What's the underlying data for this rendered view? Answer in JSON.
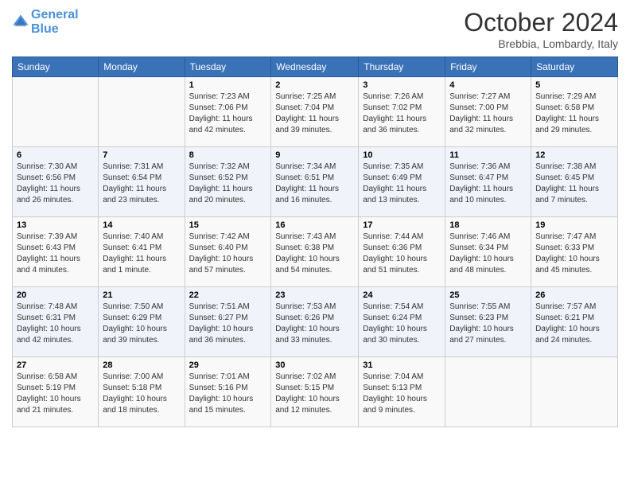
{
  "header": {
    "logo_line1": "General",
    "logo_line2": "Blue",
    "month": "October 2024",
    "location": "Brebbia, Lombardy, Italy"
  },
  "columns": [
    "Sunday",
    "Monday",
    "Tuesday",
    "Wednesday",
    "Thursday",
    "Friday",
    "Saturday"
  ],
  "weeks": [
    [
      {
        "day": "",
        "info": ""
      },
      {
        "day": "",
        "info": ""
      },
      {
        "day": "1",
        "info": "Sunrise: 7:23 AM\nSunset: 7:06 PM\nDaylight: 11 hours and 42 minutes."
      },
      {
        "day": "2",
        "info": "Sunrise: 7:25 AM\nSunset: 7:04 PM\nDaylight: 11 hours and 39 minutes."
      },
      {
        "day": "3",
        "info": "Sunrise: 7:26 AM\nSunset: 7:02 PM\nDaylight: 11 hours and 36 minutes."
      },
      {
        "day": "4",
        "info": "Sunrise: 7:27 AM\nSunset: 7:00 PM\nDaylight: 11 hours and 32 minutes."
      },
      {
        "day": "5",
        "info": "Sunrise: 7:29 AM\nSunset: 6:58 PM\nDaylight: 11 hours and 29 minutes."
      }
    ],
    [
      {
        "day": "6",
        "info": "Sunrise: 7:30 AM\nSunset: 6:56 PM\nDaylight: 11 hours and 26 minutes."
      },
      {
        "day": "7",
        "info": "Sunrise: 7:31 AM\nSunset: 6:54 PM\nDaylight: 11 hours and 23 minutes."
      },
      {
        "day": "8",
        "info": "Sunrise: 7:32 AM\nSunset: 6:52 PM\nDaylight: 11 hours and 20 minutes."
      },
      {
        "day": "9",
        "info": "Sunrise: 7:34 AM\nSunset: 6:51 PM\nDaylight: 11 hours and 16 minutes."
      },
      {
        "day": "10",
        "info": "Sunrise: 7:35 AM\nSunset: 6:49 PM\nDaylight: 11 hours and 13 minutes."
      },
      {
        "day": "11",
        "info": "Sunrise: 7:36 AM\nSunset: 6:47 PM\nDaylight: 11 hours and 10 minutes."
      },
      {
        "day": "12",
        "info": "Sunrise: 7:38 AM\nSunset: 6:45 PM\nDaylight: 11 hours and 7 minutes."
      }
    ],
    [
      {
        "day": "13",
        "info": "Sunrise: 7:39 AM\nSunset: 6:43 PM\nDaylight: 11 hours and 4 minutes."
      },
      {
        "day": "14",
        "info": "Sunrise: 7:40 AM\nSunset: 6:41 PM\nDaylight: 11 hours and 1 minute."
      },
      {
        "day": "15",
        "info": "Sunrise: 7:42 AM\nSunset: 6:40 PM\nDaylight: 10 hours and 57 minutes."
      },
      {
        "day": "16",
        "info": "Sunrise: 7:43 AM\nSunset: 6:38 PM\nDaylight: 10 hours and 54 minutes."
      },
      {
        "day": "17",
        "info": "Sunrise: 7:44 AM\nSunset: 6:36 PM\nDaylight: 10 hours and 51 minutes."
      },
      {
        "day": "18",
        "info": "Sunrise: 7:46 AM\nSunset: 6:34 PM\nDaylight: 10 hours and 48 minutes."
      },
      {
        "day": "19",
        "info": "Sunrise: 7:47 AM\nSunset: 6:33 PM\nDaylight: 10 hours and 45 minutes."
      }
    ],
    [
      {
        "day": "20",
        "info": "Sunrise: 7:48 AM\nSunset: 6:31 PM\nDaylight: 10 hours and 42 minutes."
      },
      {
        "day": "21",
        "info": "Sunrise: 7:50 AM\nSunset: 6:29 PM\nDaylight: 10 hours and 39 minutes."
      },
      {
        "day": "22",
        "info": "Sunrise: 7:51 AM\nSunset: 6:27 PM\nDaylight: 10 hours and 36 minutes."
      },
      {
        "day": "23",
        "info": "Sunrise: 7:53 AM\nSunset: 6:26 PM\nDaylight: 10 hours and 33 minutes."
      },
      {
        "day": "24",
        "info": "Sunrise: 7:54 AM\nSunset: 6:24 PM\nDaylight: 10 hours and 30 minutes."
      },
      {
        "day": "25",
        "info": "Sunrise: 7:55 AM\nSunset: 6:23 PM\nDaylight: 10 hours and 27 minutes."
      },
      {
        "day": "26",
        "info": "Sunrise: 7:57 AM\nSunset: 6:21 PM\nDaylight: 10 hours and 24 minutes."
      }
    ],
    [
      {
        "day": "27",
        "info": "Sunrise: 6:58 AM\nSunset: 5:19 PM\nDaylight: 10 hours and 21 minutes."
      },
      {
        "day": "28",
        "info": "Sunrise: 7:00 AM\nSunset: 5:18 PM\nDaylight: 10 hours and 18 minutes."
      },
      {
        "day": "29",
        "info": "Sunrise: 7:01 AM\nSunset: 5:16 PM\nDaylight: 10 hours and 15 minutes."
      },
      {
        "day": "30",
        "info": "Sunrise: 7:02 AM\nSunset: 5:15 PM\nDaylight: 10 hours and 12 minutes."
      },
      {
        "day": "31",
        "info": "Sunrise: 7:04 AM\nSunset: 5:13 PM\nDaylight: 10 hours and 9 minutes."
      },
      {
        "day": "",
        "info": ""
      },
      {
        "day": "",
        "info": ""
      }
    ]
  ]
}
